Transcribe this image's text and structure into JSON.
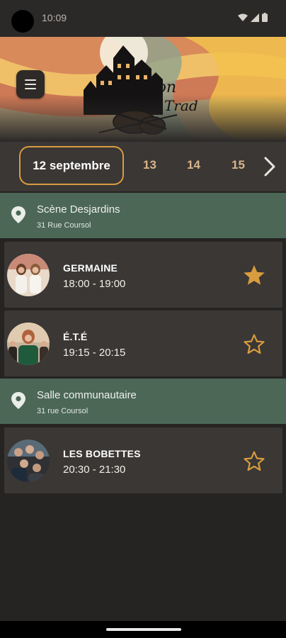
{
  "status_bar": {
    "time": "10:09"
  },
  "header": {
    "logo_line1": "Ripon",
    "logo_line2": "Trad",
    "menu_icon": "hamburger-menu-icon"
  },
  "date_selector": {
    "selected": "12 septembre",
    "others": [
      "13",
      "14",
      "15"
    ],
    "next_icon": "chevron-right-icon",
    "accent_color": "#d99c3e"
  },
  "venues": [
    {
      "name": "Scène Desjardins",
      "address": "31 Rue Coursol",
      "events": [
        {
          "artist": "GERMAINE",
          "time": "18:00 - 19:00",
          "favorite": true
        },
        {
          "artist": "É.T.É",
          "time": "19:15 - 20:15",
          "favorite": false
        }
      ]
    },
    {
      "name": "Salle communautaire",
      "address": "31 rue Coursol",
      "events": [
        {
          "artist": "LES BOBETTES",
          "time": "20:30 - 21:30",
          "favorite": false
        }
      ]
    }
  ],
  "colors": {
    "venue_band": "#4c6756",
    "card_bg": "#3a3735",
    "star": "#d99c3e"
  }
}
